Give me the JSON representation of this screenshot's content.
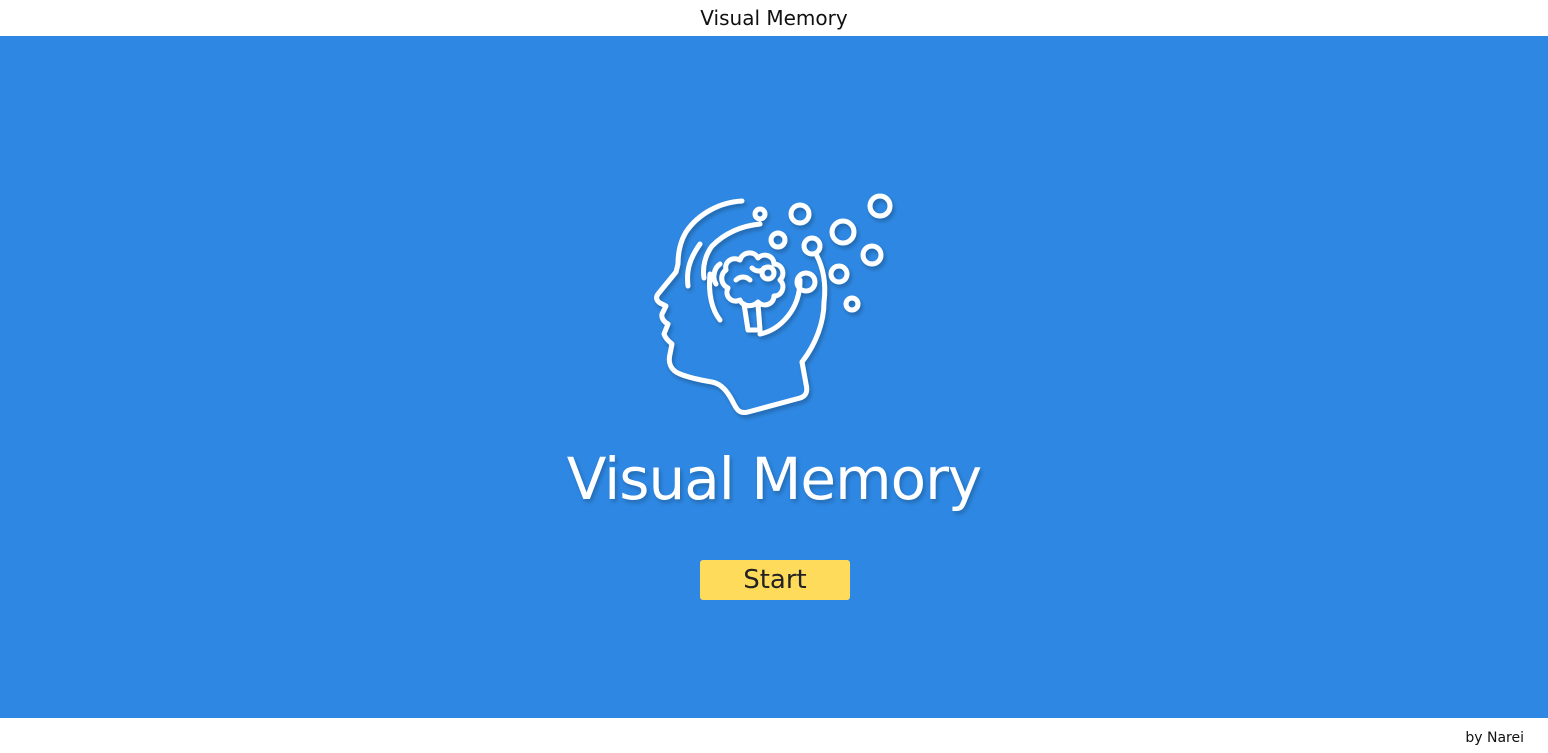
{
  "header": {
    "title": "Visual Memory"
  },
  "hero": {
    "icon": "head-brain-memory-icon",
    "title": "Visual Memory",
    "start_label": "Start",
    "background_color": "#2e88e3",
    "button_color": "#ffdb5c"
  },
  "footer": {
    "credit": "by Narei"
  }
}
